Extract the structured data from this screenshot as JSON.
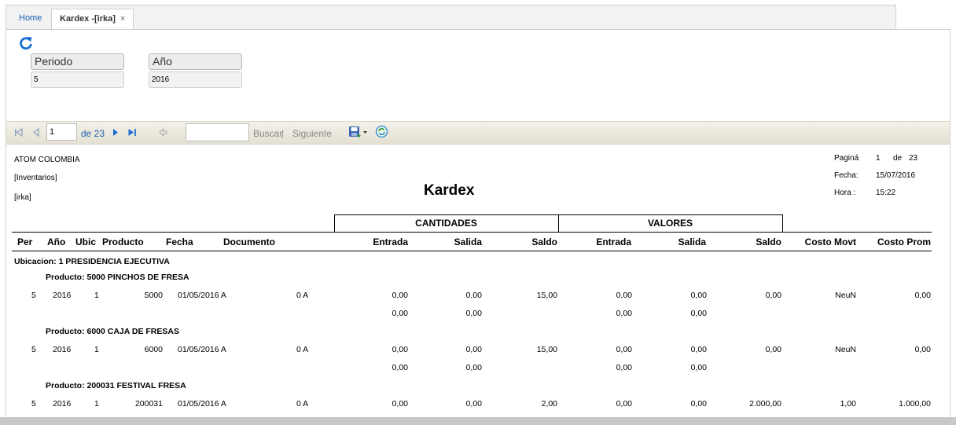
{
  "tabs": [
    {
      "label": "Home"
    },
    {
      "label": "Kardex -[irka]",
      "close": "×"
    }
  ],
  "params": {
    "periodo_label": "Periodo",
    "periodo_value": "5",
    "anio_label": "Año",
    "anio_value": "2016"
  },
  "toolbar": {
    "page_value": "1",
    "page_of": "de 23",
    "find_label": "Buscar",
    "find_sep": "|",
    "next_label": "Siguiente",
    "search_value": ""
  },
  "report": {
    "company": "ATOM COLOMBIA",
    "module": "[Inventarios]",
    "user": "[irka]",
    "title": "Kardex",
    "page_label": "Paginá",
    "page_num": "1",
    "page_of": "de",
    "page_total": "23",
    "date_label": "Fecha:",
    "date_value": "15/07/2016",
    "time_label": "Hora :",
    "time_value": "15:22",
    "group_cantidades": "CANTIDADES",
    "group_valores": "VALORES",
    "columns": {
      "per": "Per",
      "anio": "Año",
      "ubic": "Ubic",
      "producto": "Producto",
      "fecha": "Fecha",
      "documento": "Documento",
      "entrada": "Entrada",
      "salida": "Salida",
      "saldo": "Saldo",
      "v_entrada": "Entrada",
      "v_salida": "Salida",
      "v_saldo": "Saldo",
      "costo_movt": "Costo Movt",
      "costo_prom": "Costo Prom"
    },
    "ubicacion": "Ubicacion:  1  PRESIDENCIA EJECUTIVA",
    "products": [
      {
        "header": "Producto: 5000  PINCHOS DE FRESA",
        "row": {
          "per": "5",
          "anio": "2016",
          "ubic": "1",
          "producto": "5000",
          "fecha": "01/05/2016 A",
          "documento": "0 A",
          "entrada": "0,00",
          "salida": "0,00",
          "saldo": "15,00",
          "v_entrada": "0,00",
          "v_salida": "0,00",
          "v_saldo": "0,00",
          "costo_movt": "NeuN",
          "costo_prom": "0,00"
        },
        "totals": {
          "entrada": "0,00",
          "salida": "0,00",
          "v_entrada": "0,00",
          "v_salida": "0,00"
        }
      },
      {
        "header": "Producto: 6000  CAJA DE FRESAS",
        "row": {
          "per": "5",
          "anio": "2016",
          "ubic": "1",
          "producto": "6000",
          "fecha": "01/05/2016 A",
          "documento": "0 A",
          "entrada": "0,00",
          "salida": "0,00",
          "saldo": "15,00",
          "v_entrada": "0,00",
          "v_salida": "0,00",
          "v_saldo": "0,00",
          "costo_movt": "NeuN",
          "costo_prom": "0,00"
        },
        "totals": {
          "entrada": "0,00",
          "salida": "0,00",
          "v_entrada": "0,00",
          "v_salida": "0,00"
        }
      },
      {
        "header": "Producto: 200031  FESTIVAL FRESA",
        "row": {
          "per": "5",
          "anio": "2016",
          "ubic": "1",
          "producto": "200031",
          "fecha": "01/05/2016 A",
          "documento": "0 A",
          "entrada": "0,00",
          "salida": "0,00",
          "saldo": "2,00",
          "v_entrada": "0,00",
          "v_salida": "0,00",
          "v_saldo": "2.000,00",
          "costo_movt": "1,00",
          "costo_prom": "1.000,00"
        }
      }
    ]
  }
}
